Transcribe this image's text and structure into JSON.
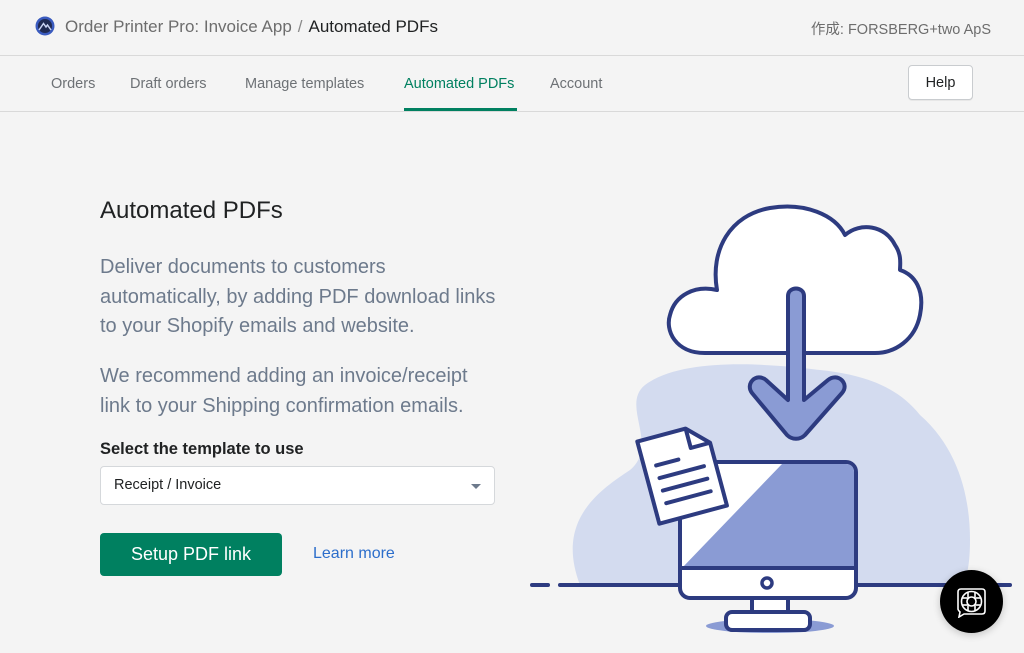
{
  "header": {
    "app_name": "Order Printer Pro: Invoice App",
    "separator": "/",
    "current_page": "Automated PDFs",
    "author": "作成: FORSBERG+two ApS",
    "logo_icon": "app-logo-mountain-icon"
  },
  "nav": {
    "tabs": [
      {
        "label": "Orders",
        "active": false
      },
      {
        "label": "Draft orders",
        "active": false
      },
      {
        "label": "Manage templates",
        "active": false
      },
      {
        "label": "Automated PDFs",
        "active": true
      },
      {
        "label": "Account",
        "active": false
      }
    ],
    "help_label": "Help"
  },
  "main": {
    "title": "Automated PDFs",
    "paragraph1": "Deliver documents to customers automatically, by adding PDF download links to your Shopify emails and website.",
    "paragraph2": "We recommend adding an invoice/receipt link to your Shipping confirmation emails.",
    "select_label": "Select the template to use",
    "select_value": "Receipt / Invoice",
    "primary_button": "Setup PDF link",
    "learn_more": "Learn more",
    "illustration": "cloud-download-to-computer-illustration"
  },
  "colors": {
    "accent_green": "#008060",
    "link_blue": "#2c6ecb",
    "illustration_navy": "#2d3b80",
    "illustration_fill": "#8a9bd4",
    "illustration_bg": "#d3dbef"
  },
  "chat_widget": {
    "icon": "lifebuoy-chat-icon"
  }
}
